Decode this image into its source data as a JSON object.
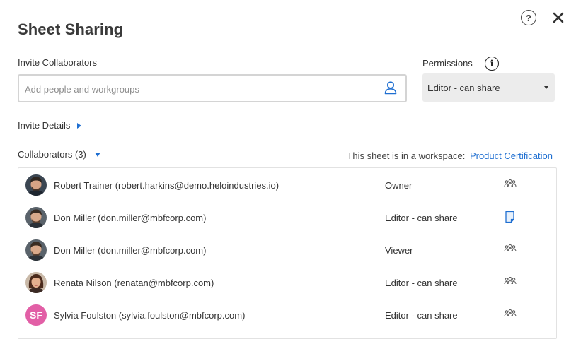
{
  "dialog": {
    "title": "Sheet Sharing",
    "help_icon": "?"
  },
  "invite": {
    "label": "Invite Collaborators",
    "placeholder": "Add people and workgroups",
    "value": ""
  },
  "permissions": {
    "label": "Permissions",
    "info_icon": "i",
    "selected": "Editor - can share"
  },
  "invite_details": {
    "label": "Invite Details"
  },
  "collaborators": {
    "header": "Collaborators (3)",
    "workspace_text": "This sheet is in a workspace:",
    "workspace_link": "Product Certification",
    "rows": [
      {
        "name": "Robert Trainer (robert.harkins@demo.heloindustries.io)",
        "role": "Owner",
        "share_icon": "group-icon"
      },
      {
        "name": "Don Miller (don.miller@mbfcorp.com)",
        "role": "Editor - can share",
        "share_icon": "sheet-icon"
      },
      {
        "name": "Don Miller (don.miller@mbfcorp.com)",
        "role": "Viewer",
        "share_icon": "group-icon"
      },
      {
        "name": "Renata Nilson (renatan@mbfcorp.com)",
        "role": "Editor - can share",
        "share_icon": "group-icon"
      },
      {
        "name": "Sylvia Foulston (sylvia.foulston@mbfcorp.com)",
        "role": "Editor - can share",
        "share_icon": "group-icon",
        "initials": "SF"
      }
    ]
  },
  "colors": {
    "accent": "#1f6fd1",
    "avatar_sf": "#e25fa6",
    "select_bg": "#ececec"
  }
}
